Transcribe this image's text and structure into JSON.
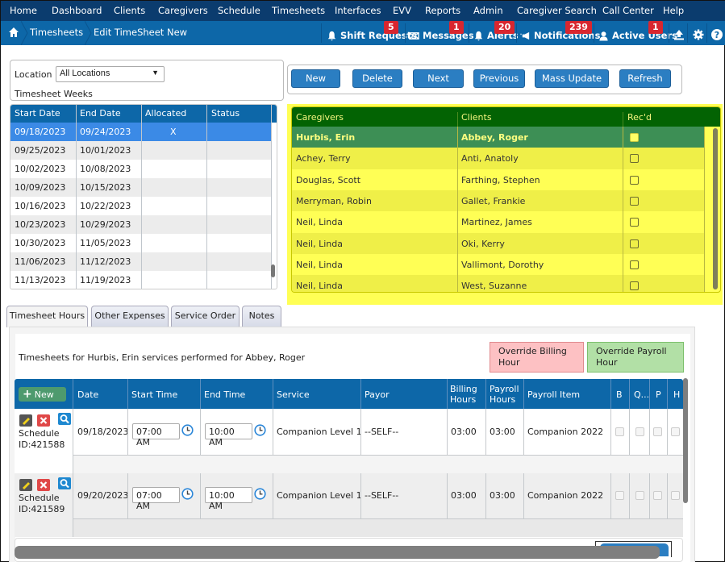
{
  "topnav": {
    "items": [
      "Home",
      "Dashboard",
      "Clients",
      "Caregivers",
      "Schedule",
      "Timesheets",
      "Interfaces",
      "EVV",
      "Reports",
      "Admin",
      "Caregiver Search",
      "Call Center",
      "Help"
    ]
  },
  "breadcrumb": {
    "home_icon": "home-icon",
    "items": [
      "Timesheets",
      "Edit TimeSheet New"
    ]
  },
  "utilities": [
    {
      "label": "Shift Requests",
      "icon": "bell-icon",
      "badge": "5"
    },
    {
      "label": "Messages",
      "icon": "envelope-icon",
      "badge": "1"
    },
    {
      "label": "Alerts",
      "icon": "bell-icon",
      "badge": "20"
    },
    {
      "label": "Notifications",
      "icon": "megaphone-icon",
      "badge": "239"
    },
    {
      "label": "Active Users",
      "icon": "user-icon",
      "badge": "1"
    }
  ],
  "utility_icons": [
    "upload-icon",
    "gear-icon",
    "help-icon"
  ],
  "location": {
    "label": "Location :",
    "selected": "All Locations"
  },
  "timesheet_weeks": {
    "title": "Timesheet Weeks",
    "columns": [
      "Start Date",
      "End Date",
      "Allocated",
      "Status"
    ],
    "rows": [
      {
        "start": "09/18/2023",
        "end": "09/24/2023",
        "allocated": "X",
        "status": "",
        "selected": true
      },
      {
        "start": "09/25/2023",
        "end": "10/01/2023",
        "allocated": "",
        "status": ""
      },
      {
        "start": "10/02/2023",
        "end": "10/08/2023",
        "allocated": "",
        "status": ""
      },
      {
        "start": "10/09/2023",
        "end": "10/15/2023",
        "allocated": "",
        "status": ""
      },
      {
        "start": "10/16/2023",
        "end": "10/22/2023",
        "allocated": "",
        "status": ""
      },
      {
        "start": "10/23/2023",
        "end": "10/29/2023",
        "allocated": "",
        "status": ""
      },
      {
        "start": "10/30/2023",
        "end": "11/05/2023",
        "allocated": "",
        "status": ""
      },
      {
        "start": "11/06/2023",
        "end": "11/12/2023",
        "allocated": "",
        "status": ""
      },
      {
        "start": "11/13/2023",
        "end": "11/19/2023",
        "allocated": "",
        "status": ""
      }
    ]
  },
  "actions": [
    "New",
    "Delete",
    "Next",
    "Previous",
    "Mass Update",
    "Refresh"
  ],
  "caregivers_grid": {
    "columns": [
      "Caregivers",
      "Clients",
      "Rec'd"
    ],
    "rows": [
      {
        "caregiver": "Hurbis, Erin",
        "client": "Abbey, Roger",
        "received": false,
        "selected": true
      },
      {
        "caregiver": "Achey, Terry",
        "client": "Anti, Anatoly",
        "received": false
      },
      {
        "caregiver": "Douglas, Scott",
        "client": "Farthing, Stephen",
        "received": false
      },
      {
        "caregiver": "Merryman, Robin",
        "client": "Gallet, Frankie",
        "received": false
      },
      {
        "caregiver": "Neil, Linda",
        "client": "Martinez, James",
        "received": false
      },
      {
        "caregiver": "Neil, Linda",
        "client": "Oki, Kerry",
        "received": false
      },
      {
        "caregiver": "Neil, Linda",
        "client": "Vallimont, Dorothy",
        "received": false
      },
      {
        "caregiver": "Neil, Linda",
        "client": "West, Suzanne",
        "received": false
      }
    ]
  },
  "tabs": [
    {
      "label": "Timesheet Hours",
      "active": true
    },
    {
      "label": "Other Expenses"
    },
    {
      "label": "Service Order"
    },
    {
      "label": "Notes"
    }
  ],
  "timesheet_hours": {
    "title": "Timesheets for Hurbis, Erin services performed for Abbey, Roger",
    "override_billing": "Override Billing Hour",
    "override_payroll": "Override Payroll Hour",
    "new_label": "New",
    "columns": [
      "Date",
      "Start Time",
      "End Time",
      "Service",
      "Payor",
      "Billing Hours",
      "Payroll Hours",
      "Payroll Item",
      "B",
      "Q...",
      "P",
      "H"
    ],
    "rows": [
      {
        "schedule_label": "Schedule",
        "schedule_id": "ID:421588",
        "date": "09/18/2023",
        "start": "07:00 AM",
        "end": "10:00 AM",
        "service": "Companion Level 1",
        "payor": "--SELF--",
        "billing_hours": "03:00",
        "payroll_hours": "03:00",
        "payroll_item": "Companion 2022"
      },
      {
        "schedule_label": "Schedule",
        "schedule_id": "ID:421589",
        "date": "09/20/2023",
        "start": "07:00 AM",
        "end": "10:00 AM",
        "service": "Companion Level 1",
        "payor": "--SELF--",
        "billing_hours": "03:00",
        "payroll_hours": "03:00",
        "payroll_item": "Companion 2022"
      }
    ]
  },
  "colors": {
    "nav_dark": "#0b3c6e",
    "nav_blue": "#0d67a8",
    "badge_red": "#d8262f",
    "selected_row": "#3b8ae6",
    "caregiver_header": "#036303",
    "caregiver_selected": "#3d8f55",
    "highlight_yellow": "#ffff55"
  }
}
